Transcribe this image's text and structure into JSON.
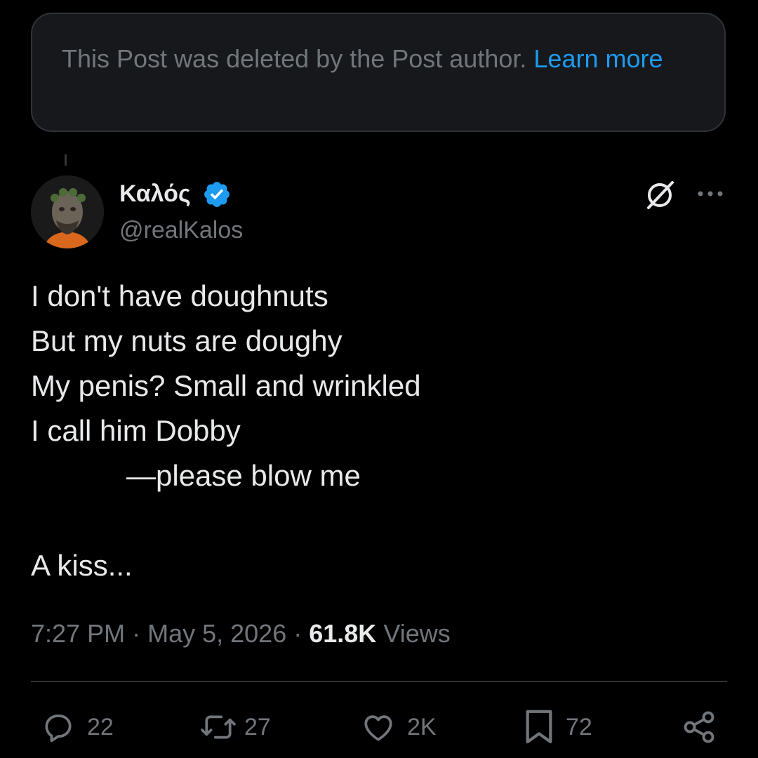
{
  "deleted_notice": {
    "text": "This Post was deleted by the Post author.",
    "link_label": "Learn more"
  },
  "post": {
    "author_name": "Καλός",
    "handle": "@realKalos",
    "lines": [
      "I don't have doughnuts",
      "But my nuts are doughy",
      "My penis? Small and wrinkled",
      "I call him Dobby",
      "—please blow me",
      "",
      "A kiss..."
    ],
    "time": "7:27 PM",
    "date": "May 5, 2026",
    "views_count": "61.8K",
    "views_label": "Views"
  },
  "actions": {
    "replies": "22",
    "reposts": "27",
    "likes": "2K",
    "bookmarks": "72"
  },
  "colors": {
    "background": "#000000",
    "text": "#e7e9ea",
    "muted": "#71767b",
    "accent": "#1d9bf0",
    "border": "#2f3336"
  },
  "icons": [
    "verified-badge-icon",
    "grok-icon",
    "more-icon",
    "reply-icon",
    "repost-icon",
    "like-icon",
    "bookmark-icon",
    "share-icon"
  ]
}
